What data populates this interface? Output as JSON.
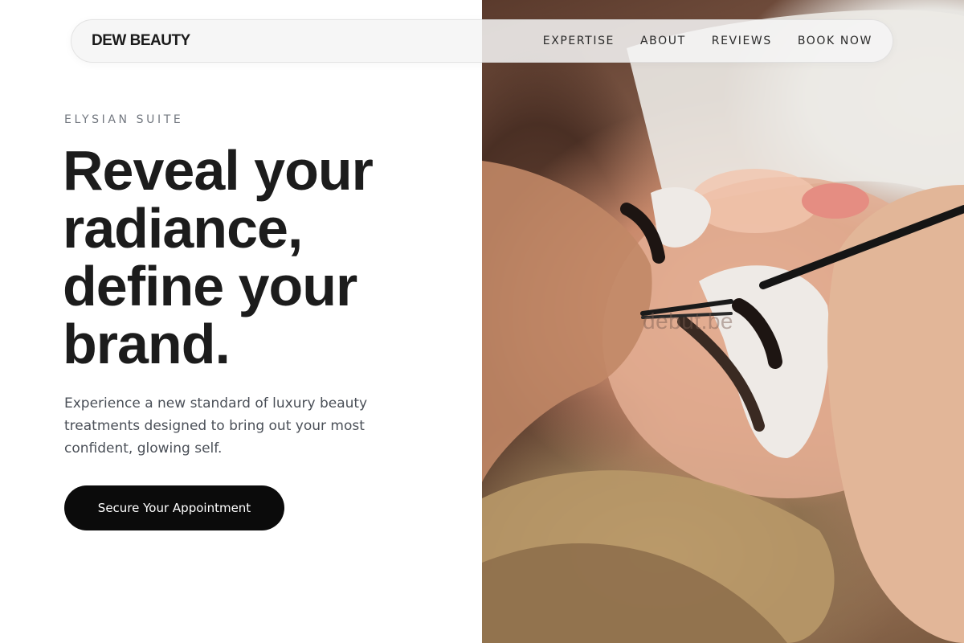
{
  "nav": {
    "brand": "DEW BEAUTY",
    "links": [
      "EXPERTISE",
      "ABOUT",
      "REVIEWS",
      "BOOK NOW"
    ]
  },
  "hero": {
    "eyebrow": "ELYSIAN SUITE",
    "headline_lines": [
      "Reveal your",
      "radiance,",
      "define your",
      "brand."
    ],
    "description": "Experience a new standard of luxury beauty treatments designed to bring out your most confident, glowing self.",
    "cta_label": "Secure Your Appointment"
  },
  "photo": {
    "watermark": "debut.be"
  },
  "colors": {
    "background": "#ffffff",
    "text": "#1c1c1c",
    "muted": "#737880",
    "button": "#0b0b0b",
    "button_text": "#ffffff"
  }
}
